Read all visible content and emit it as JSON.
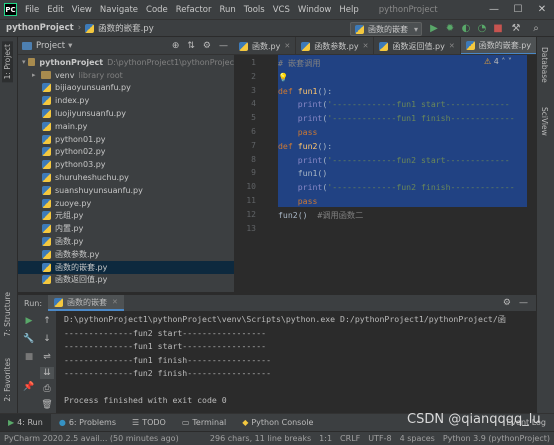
{
  "menubar": {
    "logo": "PC",
    "items": [
      "File",
      "Edit",
      "View",
      "Navigate",
      "Code",
      "Refactor",
      "Run",
      "Tools",
      "VCS",
      "Window",
      "Help"
    ],
    "project_title": "pythonProject",
    "window_buttons": [
      "—",
      "☐",
      "✕"
    ]
  },
  "navbar": {
    "breadcrumb": [
      "pythonProject",
      "函数的嵌套.py"
    ],
    "run_config": "函数的嵌套"
  },
  "left_stripe": {
    "project_tab": "1: Project",
    "structure_tab": "7: Structure",
    "favorites_tab": "2: Favorites"
  },
  "right_stripe": {
    "database_tab": "Database",
    "sciview_tab": "SciView"
  },
  "project_panel": {
    "header": "Project",
    "root": {
      "name": "pythonProject",
      "path": "D:\\pythonProject1\\pythonProjec"
    },
    "venv": {
      "name": "venv",
      "note": "library root"
    },
    "files": [
      "bijiaoyunsuanfu.py",
      "index.py",
      "luojiyunsuanfu.py",
      "main.py",
      "python01.py",
      "python02.py",
      "python03.py",
      "shuruheshuchu.py",
      "suanshuyunsuanfu.py",
      "zuoye.py",
      "元组.py",
      "内置.py",
      "函数.py",
      "函数参数.py",
      "函数的嵌套.py",
      "函数返回值.py"
    ],
    "selected_index": 14
  },
  "editor": {
    "tabs": [
      "函数.py",
      "函数参数.py",
      "函数返回值.py",
      "函数的嵌套.py"
    ],
    "active_tab": 3,
    "inspection": "4",
    "line_numbers": [
      "1",
      "2",
      "3",
      "4",
      "5",
      "6",
      "7",
      "8",
      "9",
      "10",
      "11",
      "12",
      "13"
    ],
    "lines": [
      {
        "comment": "# 嵌套调用"
      },
      {
        "bulb": "💡"
      },
      {
        "kw": "def ",
        "fn": "fun1",
        "rest": "():"
      },
      {
        "indent": "    ",
        "bi": "print",
        "rest": "(",
        "str": "'-------------fun1 start-------------",
        "end": ""
      },
      {
        "indent": "    ",
        "bi": "print",
        "rest": "(",
        "str": "'-------------fun1 finish-------------",
        "end": ""
      },
      {
        "indent": "    ",
        "kw": "pass"
      },
      {
        "kw": "def ",
        "fn": "fun2",
        "rest": "():"
      },
      {
        "indent": "    ",
        "bi": "print",
        "rest": "(",
        "str": "'-------------fun2 start-------------",
        "end": ""
      },
      {
        "indent": "    ",
        "plain": "fun1()"
      },
      {
        "indent": "    ",
        "bi": "print",
        "rest": "(",
        "str": "'-------------fun2 finish-------------",
        "end": ""
      },
      {
        "indent": "    ",
        "kw": "pass"
      },
      {
        "plain": "fun2()",
        "comment": "  #调用函数二"
      },
      {
        "plain": ""
      }
    ]
  },
  "run_panel": {
    "label": "Run:",
    "config_tab": "函数的嵌套",
    "console": [
      "D:\\pythonProject1\\pythonProject\\venv\\Scripts\\python.exe D:/pythonProject1/pythonProject/函",
      "--------------fun2 start-----------------",
      "--------------fun1 start-----------------",
      "--------------fun1 finish-----------------",
      "--------------fun2 finish-----------------",
      "",
      "Process finished with exit code 0"
    ]
  },
  "bottom_tabs": [
    "4: Run",
    "6: Problems",
    "TODO",
    "Terminal",
    "Python Console",
    "Event Log"
  ],
  "status": {
    "left": "PyCharm 2020.2.5 avail... (50 minutes ago)",
    "chars": "296 chars, 11 line breaks",
    "pos": "1:1",
    "crlf": "CRLF",
    "enc": "UTF-8",
    "indent": "4 spaces",
    "interp": "Python 3.9 (pythonProject)"
  },
  "watermark": "CSDN @qianqqqq_lu",
  "colors": {
    "accent": "#4a88c7",
    "selection": "#214283",
    "keyword": "#cc7832",
    "string": "#6a8759"
  }
}
